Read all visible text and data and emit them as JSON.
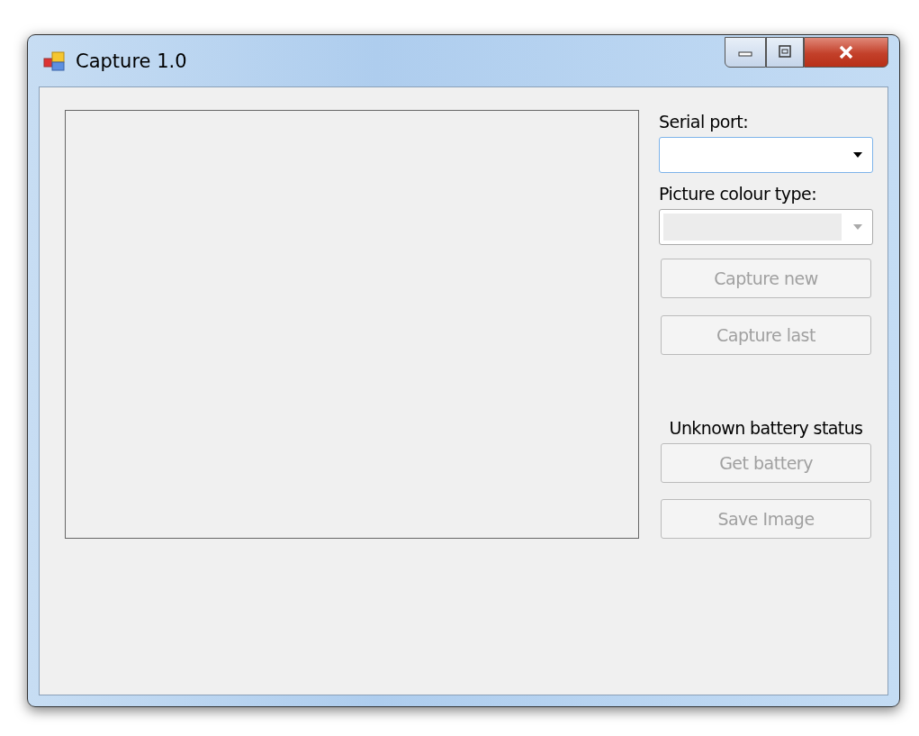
{
  "window": {
    "title": "Capture 1.0"
  },
  "serial_port": {
    "label": "Serial port:",
    "dropdown": {
      "disabled": false
    }
  },
  "colour_type": {
    "label": "Picture colour type:",
    "dropdown": {
      "disabled": true
    }
  },
  "capture_buttons": [
    {
      "label": "Capture new",
      "disabled": true
    },
    {
      "label": "Capture last",
      "disabled": true
    }
  ],
  "battery_status": "Unknown battery status",
  "bottom_buttons": [
    {
      "label": "Get battery",
      "disabled": true
    },
    {
      "label": "Save Image",
      "disabled": true
    }
  ]
}
